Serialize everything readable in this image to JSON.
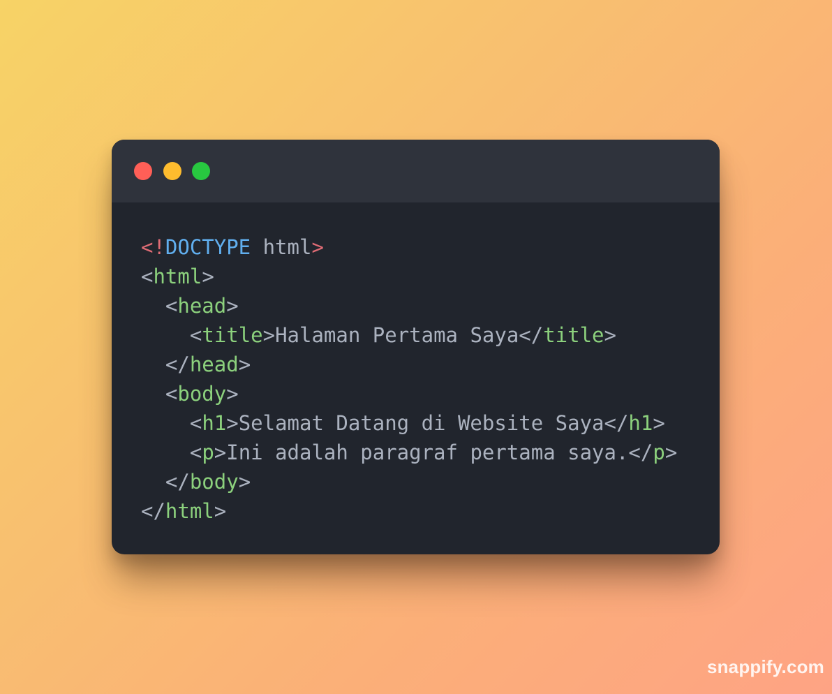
{
  "colors": {
    "close_dot": "#ff5f57",
    "minimize_dot": "#febc2e",
    "maximize_dot": "#28c840",
    "tag": "#8cd17d",
    "bracket": "#abb2bf",
    "text": "#abb2bf",
    "doctype_punct": "#e06c75",
    "doctype_keyword": "#61afef"
  },
  "code_lines": [
    [
      {
        "t": "<!",
        "k": "doctype_punct"
      },
      {
        "t": "DOCTYPE",
        "k": "doctype_keyword"
      },
      {
        "t": " html",
        "k": "text"
      },
      {
        "t": ">",
        "k": "doctype_punct"
      }
    ],
    [
      {
        "t": "<",
        "k": "bracket"
      },
      {
        "t": "html",
        "k": "tag"
      },
      {
        "t": ">",
        "k": "bracket"
      }
    ],
    [
      {
        "t": "  <",
        "k": "bracket"
      },
      {
        "t": "head",
        "k": "tag"
      },
      {
        "t": ">",
        "k": "bracket"
      }
    ],
    [
      {
        "t": "    <",
        "k": "bracket"
      },
      {
        "t": "title",
        "k": "tag"
      },
      {
        "t": ">",
        "k": "bracket"
      },
      {
        "t": "Halaman Pertama Saya",
        "k": "text"
      },
      {
        "t": "</",
        "k": "bracket"
      },
      {
        "t": "title",
        "k": "tag"
      },
      {
        "t": ">",
        "k": "bracket"
      }
    ],
    [
      {
        "t": "  </",
        "k": "bracket"
      },
      {
        "t": "head",
        "k": "tag"
      },
      {
        "t": ">",
        "k": "bracket"
      }
    ],
    [
      {
        "t": "  <",
        "k": "bracket"
      },
      {
        "t": "body",
        "k": "tag"
      },
      {
        "t": ">",
        "k": "bracket"
      }
    ],
    [
      {
        "t": "    <",
        "k": "bracket"
      },
      {
        "t": "h1",
        "k": "tag"
      },
      {
        "t": ">",
        "k": "bracket"
      },
      {
        "t": "Selamat Datang di Website Saya",
        "k": "text"
      },
      {
        "t": "</",
        "k": "bracket"
      },
      {
        "t": "h1",
        "k": "tag"
      },
      {
        "t": ">",
        "k": "bracket"
      }
    ],
    [
      {
        "t": "    <",
        "k": "bracket"
      },
      {
        "t": "p",
        "k": "tag"
      },
      {
        "t": ">",
        "k": "bracket"
      },
      {
        "t": "Ini adalah paragraf pertama saya.",
        "k": "text"
      },
      {
        "t": "</",
        "k": "bracket"
      },
      {
        "t": "p",
        "k": "tag"
      },
      {
        "t": ">",
        "k": "bracket"
      }
    ],
    [
      {
        "t": "  </",
        "k": "bracket"
      },
      {
        "t": "body",
        "k": "tag"
      },
      {
        "t": ">",
        "k": "bracket"
      }
    ],
    [
      {
        "t": "</",
        "k": "bracket"
      },
      {
        "t": "html",
        "k": "tag"
      },
      {
        "t": ">",
        "k": "bracket"
      }
    ]
  ],
  "watermark": "snappify.com"
}
